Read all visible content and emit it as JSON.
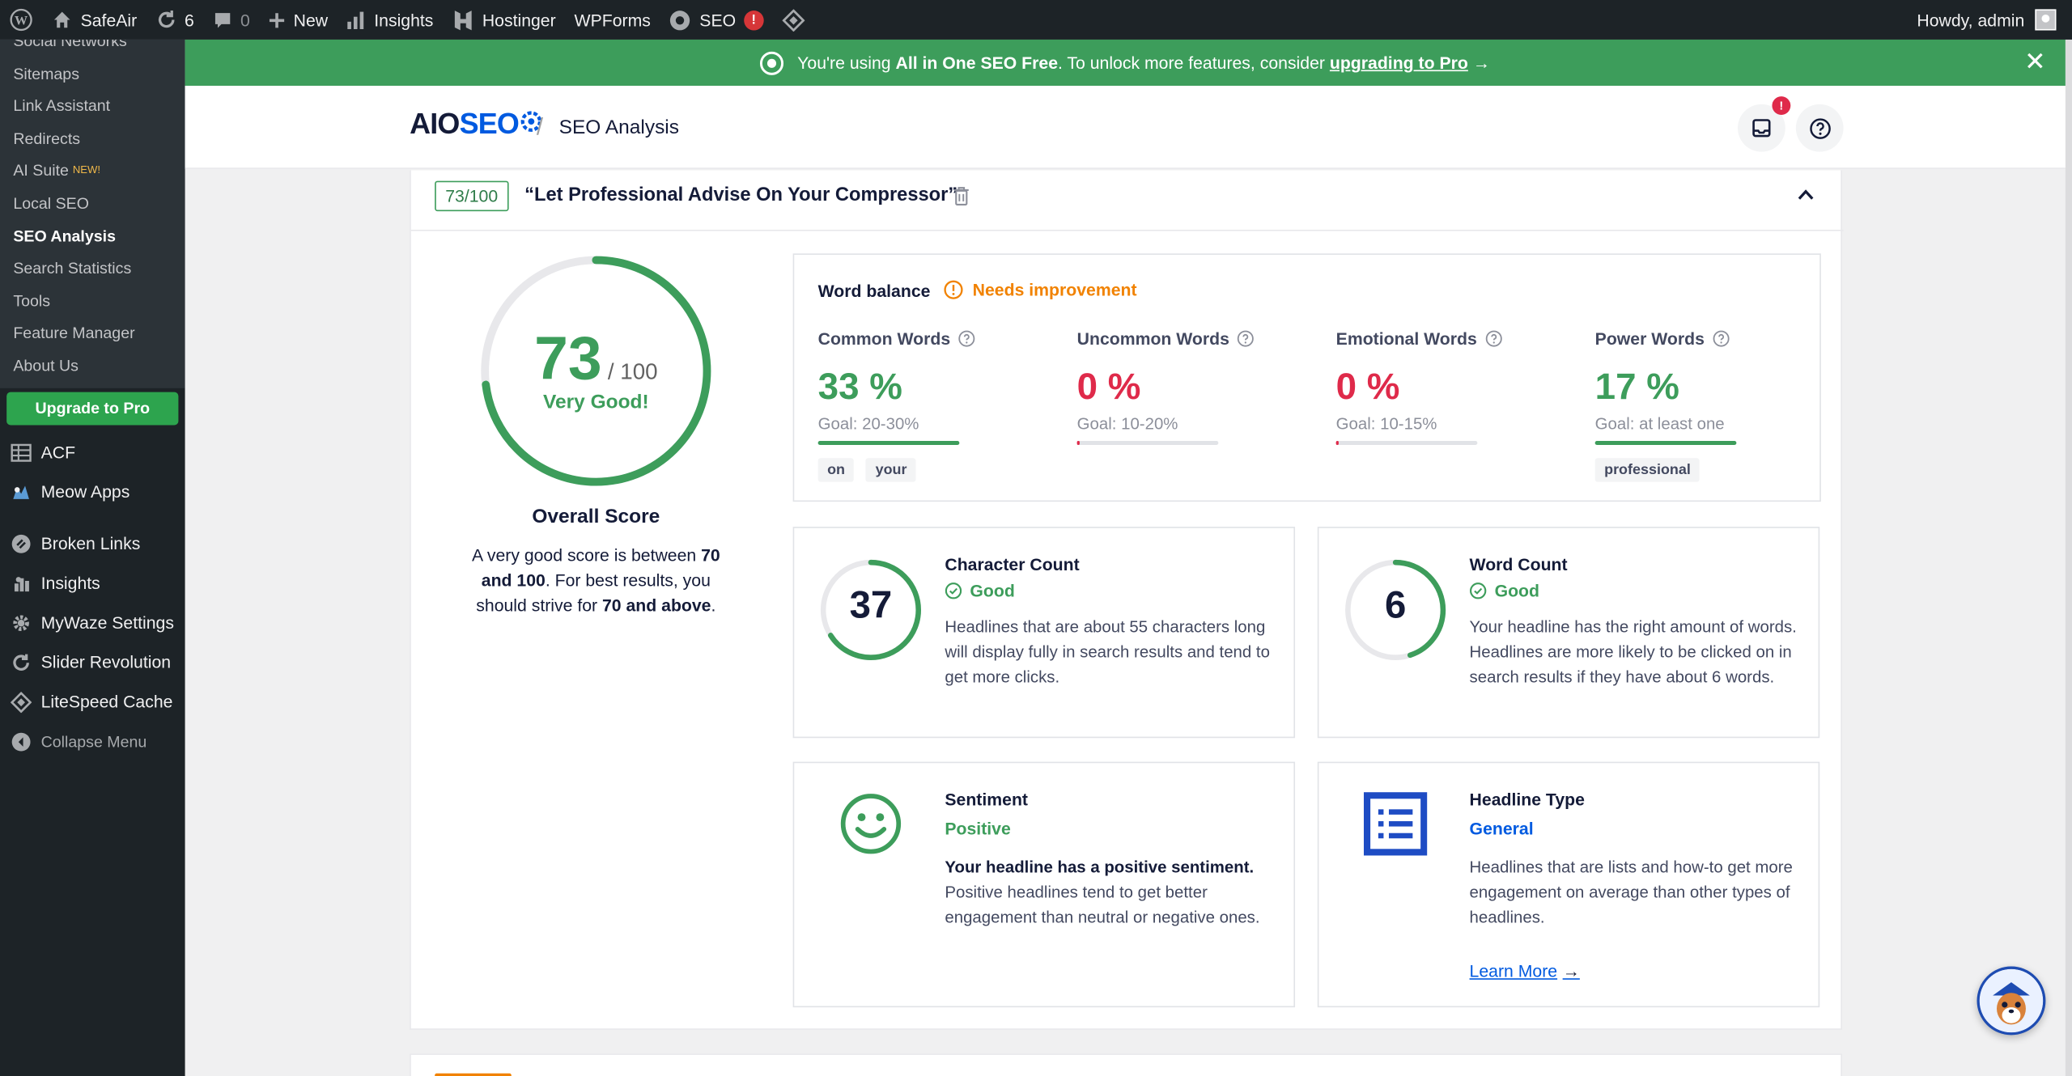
{
  "admin_bar": {
    "site_name": "SafeAir",
    "updates_count": "6",
    "comments_count": "0",
    "new_label": "New",
    "insights_label": "Insights",
    "hostinger_label": "Hostinger",
    "wpforms_label": "WPForms",
    "seo_label": "SEO",
    "seo_badge": "!",
    "greeting": "Howdy, admin"
  },
  "sidebar": {
    "submenu": [
      {
        "label": "Social Networks"
      },
      {
        "label": "Sitemaps"
      },
      {
        "label": "Link Assistant"
      },
      {
        "label": "Redirects"
      },
      {
        "label": "AI Suite",
        "badge": "NEW!"
      },
      {
        "label": "Local SEO"
      },
      {
        "label": "SEO Analysis",
        "current": true
      },
      {
        "label": "Search Statistics"
      },
      {
        "label": "Tools"
      },
      {
        "label": "Feature Manager"
      },
      {
        "label": "About Us"
      }
    ],
    "upgrade_label": "Upgrade to Pro",
    "menu": [
      {
        "label": "ACF",
        "icon": "table-icon"
      },
      {
        "label": "Meow Apps",
        "icon": "meow-apps-icon"
      },
      {
        "label": "Broken Links",
        "icon": "broken-links-icon"
      },
      {
        "label": "Insights",
        "icon": "insights-icon"
      },
      {
        "label": "MyWaze Settings",
        "icon": "gear-icon"
      },
      {
        "label": "Slider Revolution",
        "icon": "slider-icon"
      },
      {
        "label": "LiteSpeed Cache",
        "icon": "diamond-icon"
      }
    ],
    "collapse_label": "Collapse Menu"
  },
  "notice": {
    "prefix": "You're using",
    "product": "All in One SEO Free",
    "middle": ". To unlock more features, consider",
    "link": "upgrading to Pro",
    "arrow": "→"
  },
  "header": {
    "logo_part1": "AIO",
    "logo_part2": "SEO",
    "separator": "/",
    "breadcrumb": "SEO Analysis",
    "notification_badge": "!"
  },
  "analysis": {
    "score_badge": "73/100",
    "headline": "“Let Professional Advise On Your Compressor”",
    "score": "73",
    "score_max": "/ 100",
    "score_value": 73,
    "score_label": "Very Good!",
    "overall_title": "Overall Score",
    "overall_desc_1": "A very good score is between ",
    "overall_desc_b1": "70 and 100",
    "overall_desc_2": ". For best results, you should strive for ",
    "overall_desc_b2": "70 and above",
    "overall_desc_3": "."
  },
  "word_balance": {
    "title": "Word balance",
    "status": "Needs improvement",
    "columns": [
      {
        "name": "Common Words",
        "pct": "33 %",
        "goal": "Goal: 20-30%",
        "fill": 1.0,
        "color": "#3d9d5b",
        "tags": [
          "on",
          "your"
        ]
      },
      {
        "name": "Uncommon Words",
        "pct": "0 %",
        "goal": "Goal: 10-20%",
        "fill": 0.02,
        "color": "#df2a4a",
        "tags": []
      },
      {
        "name": "Emotional Words",
        "pct": "0 %",
        "goal": "Goal: 10-15%",
        "fill": 0.02,
        "color": "#df2a4a",
        "tags": []
      },
      {
        "name": "Power Words",
        "pct": "17 %",
        "goal": "Goal: at least one",
        "fill": 1.0,
        "color": "#3d9d5b",
        "tags": [
          "professional"
        ]
      }
    ]
  },
  "character_count": {
    "value": "37",
    "ring_fraction": 0.66,
    "title": "Character Count",
    "status": "Good",
    "text": "Headlines that are about 55 characters long will display fully in search results and tend to get more clicks."
  },
  "word_count": {
    "value": "6",
    "ring_fraction": 0.45,
    "title": "Word Count",
    "status": "Good",
    "text": "Your headline has the right amount of words. Headlines are more likely to be clicked on in search results if they have about 6 words."
  },
  "sentiment": {
    "title": "Sentiment",
    "status": "Positive",
    "text_bold": "Your headline has a positive sentiment.",
    "text": " Positive headlines tend to get better engagement than neutral or negative ones."
  },
  "headline_type": {
    "title": "Headline Type",
    "status": "General",
    "text": "Headlines that are lists and how-to get more engagement on average than other types of headlines.",
    "learn_more": "Learn More",
    "arrow": "→"
  },
  "colors": {
    "good": "#3d9d5b",
    "bad": "#df2a4a",
    "warning": "#f18200",
    "brand_blue": "#005ae0"
  }
}
